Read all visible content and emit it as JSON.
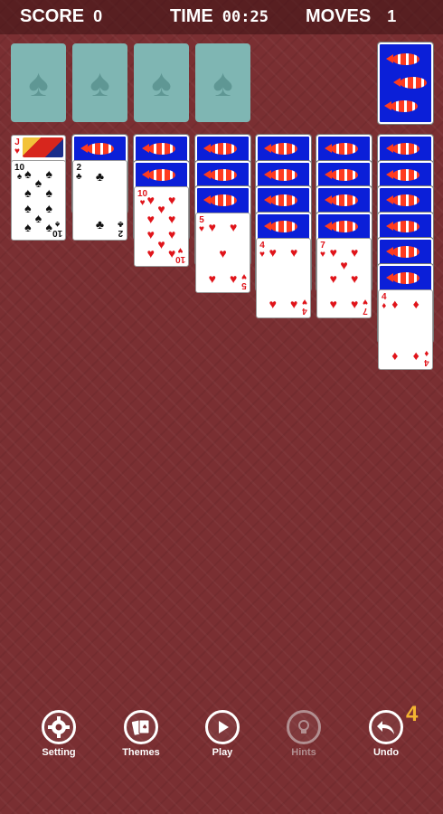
{
  "header": {
    "score_label": "SCORE",
    "score_value": "0",
    "time_label": "TIME",
    "time_value": "00:25",
    "moves_label": "MOVES",
    "moves_value": "1"
  },
  "foundations": [
    {
      "symbol": "♠"
    },
    {
      "symbol": "♠"
    },
    {
      "symbol": "♠"
    },
    {
      "symbol": "♠"
    }
  ],
  "stock": {
    "face": "down",
    "back": "clownfish-back"
  },
  "tableau": [
    {
      "face_down": 0,
      "face_up": [
        "J♥",
        "10♠"
      ]
    },
    {
      "face_down": 1,
      "face_up": [
        "2♣"
      ]
    },
    {
      "face_down": 2,
      "face_up": [
        "10♥"
      ]
    },
    {
      "face_down": 3,
      "face_up": [
        "5♥"
      ]
    },
    {
      "face_down": 4,
      "face_up": [
        "4♥"
      ]
    },
    {
      "face_down": 4,
      "face_up": [
        "7♥"
      ]
    },
    {
      "face_down": 6,
      "face_up": [
        "4♦"
      ]
    }
  ],
  "cards": {
    "jack_hearts": {
      "rank": "J",
      "suit": "♥"
    },
    "ten_spades": {
      "rank": "10",
      "suit": "♠"
    },
    "two_clubs": {
      "rank": "2",
      "suit": "♣"
    },
    "ten_hearts": {
      "rank": "10",
      "suit": "♥"
    },
    "five_hearts": {
      "rank": "5",
      "suit": "♥"
    },
    "four_hearts": {
      "rank": "4",
      "suit": "♥"
    },
    "seven_hearts": {
      "rank": "7",
      "suit": "♥"
    },
    "four_diamonds": {
      "rank": "4",
      "suit": "♦"
    }
  },
  "toolbar": {
    "setting": "Setting",
    "themes": "Themes",
    "play": "Play",
    "hints": "Hints",
    "undo": "Undo",
    "undo_count": "4"
  },
  "colors": {
    "table": "#7a2f32",
    "card_back": "#0b1fd8",
    "foundation": "#7fb6b3",
    "badge": "#f3b531"
  }
}
